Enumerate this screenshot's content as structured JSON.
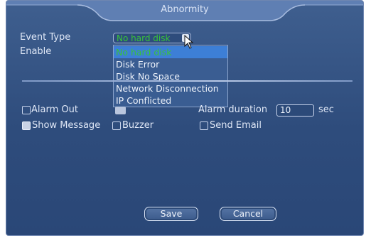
{
  "window": {
    "title": "Abnormity"
  },
  "labels": {
    "event_type": "Event Type",
    "enable": "Enable",
    "alarm_out": "Alarm Out",
    "alarm_duration": "Alarm duration",
    "seconds_unit": "sec",
    "show_message": "Show Message",
    "buzzer": "Buzzer",
    "send_email": "Send Email"
  },
  "event_type_select": {
    "selected": "No hard disk",
    "options": [
      "No hard disk",
      "Disk Error",
      "Disk No Space",
      "Network Disconnection",
      "IP Conflicted"
    ]
  },
  "fields": {
    "alarm_duration_value": "10"
  },
  "checkboxes": {
    "alarm_out": false,
    "show_message": true,
    "buzzer": false,
    "send_email": false
  },
  "buttons": {
    "save": "Save",
    "cancel": "Cancel"
  }
}
